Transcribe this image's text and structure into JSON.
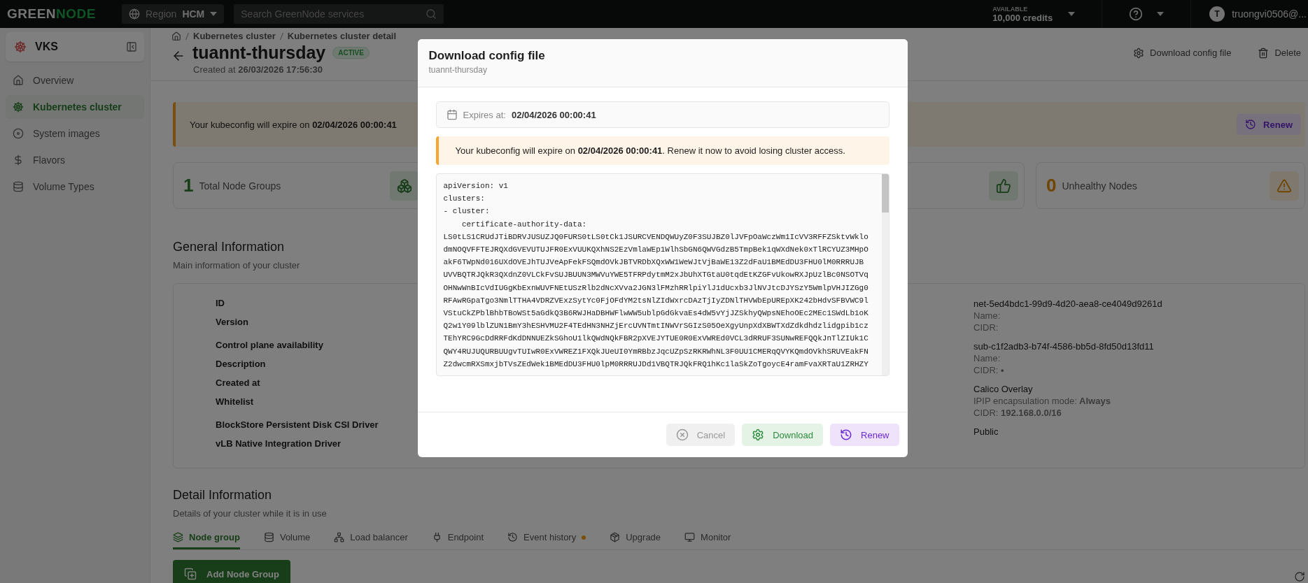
{
  "topbar": {
    "logo": {
      "text": "GREEN",
      "accent": "NODE"
    },
    "region": {
      "label": "Region",
      "value": "HCM"
    },
    "search": {
      "placeholder": "Search GreenNode services"
    },
    "credits": {
      "caption": "AVAILABLE",
      "value": "10,000 credits"
    },
    "user": {
      "initial": "T",
      "name": "truongvi0506@..."
    }
  },
  "sidebar": {
    "product": "VKS",
    "items": [
      {
        "label": "Overview",
        "selected": false
      },
      {
        "label": "Kubernetes cluster",
        "selected": true
      },
      {
        "label": "System images",
        "selected": false
      },
      {
        "label": "Flavors",
        "selected": false
      },
      {
        "label": "Volume Types",
        "selected": false
      }
    ]
  },
  "page": {
    "breadcrumbs": [
      "Kubernetes cluster",
      "Kubernetes cluster detail"
    ],
    "title": "tuannt-thursday",
    "status": "ACTIVE",
    "created_label": "Created at",
    "created_value": "26/03/2026 17:56:30",
    "actions": [
      "Download config file",
      "Delete"
    ]
  },
  "banner": {
    "text": "Your kubeconfig will expire on **02/04/2026 00:00:41**",
    "button": "Renew"
  },
  "stats": [
    {
      "value": "1",
      "label": "Total Node Groups",
      "kind": "total"
    },
    {
      "kind": "healthy"
    },
    {
      "value": "0",
      "label": "Unhealthy Nodes",
      "kind": "unhealthy"
    }
  ],
  "general": {
    "title": "General Information",
    "subtitle": "Main information of your cluster",
    "labels": [
      "ID",
      "Version",
      "Control plane availability",
      "Description",
      "Created at",
      "Whitelist",
      "BlockStore Persistent Disk CSI Driver",
      "vLB Native Integration Driver"
    ],
    "details": [
      {
        "value": "net-5ed4bdc1-99d9-4d20-aea8-ce4049d9261d",
        "lines": [
          {
            "label": "Name:"
          },
          {
            "label": "CIDR:"
          }
        ]
      },
      {
        "value": "sub-c1f2adb3-b74f-4586-bb5d-8fd50d13fd11",
        "lines": [
          {
            "label": "Name:"
          },
          {
            "label": "CIDR:",
            "value": "•"
          }
        ]
      },
      {
        "value": "Calico Overlay",
        "lines": [
          {
            "label": "IPIP encapsulation mode:",
            "value": "Always"
          },
          {
            "label": "CIDR:",
            "value": "192.168.0.0/16"
          }
        ]
      },
      {
        "value": "Public"
      }
    ]
  },
  "detail": {
    "title": "Detail Information",
    "subtitle": "Details of your cluster while it is in use",
    "tabs": [
      {
        "label": "Node group",
        "selected": true,
        "notify": false
      },
      {
        "label": "Volume",
        "selected": false,
        "notify": false
      },
      {
        "label": "Load balancer",
        "selected": false,
        "notify": false
      },
      {
        "label": "Endpoint",
        "selected": false,
        "notify": false
      },
      {
        "label": "Event history",
        "selected": false,
        "notify": true
      },
      {
        "label": "Upgrade",
        "selected": false,
        "notify": false
      },
      {
        "label": "Monitor",
        "selected": false,
        "notify": false
      }
    ],
    "add_button": "Add Node Group"
  },
  "modal": {
    "title": "Download config file",
    "subtitle": "tuannt-thursday",
    "expires_label": "Expires at:",
    "expires_value": "02/04/2026 00:00:41",
    "warning": "Your kubeconfig will expire on **02/04/2026 00:00:41**. Renew it now to avoid losing cluster access.",
    "config_lines": [
      "apiVersion: v1",
      "clusters:",
      "- cluster:",
      "    certificate-authority-data:",
      "LS0tLS1CRUdJTiBDRVJUSUZJQ0FURS0tLS0tCk1JSURCVENDQWUyZ0F3SUJBZ0lJVFpOaWczWm1IcVV3RFFZSktvWklo",
      "dmNOQVFFTEJRQXdGVEVUTUJFR0ExVUUKQXhNS2EzVmlaWEp1WlhSbGN6QWVGdzB5TmpBek1qWXdNek0xTlRCYUZ3MHpO",
      "akF6TWpNd016UXdOVEJhTUJVeApFekFSQmdOVkJBTVRDbXQxWW1WeWJtVjBaWE13Z2dFaU1BMEdDU3FHU0lM0RRRUJB",
      "UVVBQTRJQkR3QXdnZ0VLCkFvSUJBUUN3MWVuYWE5TFRPdytmM2xJbUhXTGtaU0tqdEtKZGFvUkowRXJpUzlBc0NSOTVq",
      "OHNwWnBIcVdIUGgKbExnWUVFNEtUSzRlb2dNcXVva2JGN3lFMzhRRlpiYlJ1dUcxb3JlNVJtcDJYSzY5WmlpVHJIZGg0",
      "RFAwRGpaTgo3NmlTTHA4VDRZVExzSytYc0FjOFdYM2tsNlZIdWxrcDAzTjIyZDNlTHVWbEpUREpXK242bHdvSFBVWC9l",
      "VStuCkZPblBhbTBoWSt5aGdkQ3B6RWJHaDBHWFlwWW5ublpGdGkvaEs4dW5vYjJZSkhyQWpsNEhoOEc2MEc1SWdLb1oK",
      "Q2w1Y09lblZUN1BmY3hESHVMU2F4TEdHN3NHZjErcUVNTmtINWVrSGIzS05OeXgyUnpXdXBWTXdZdkdhdzlidgpib1cz",
      "TEhYRC9GcDdRRFdKdDNNUEZkSGhoU1lkQWdNQkFBR2pXVEJYTUE0R0ExVWREd0VCL3dRRUF3SUNwREFQQkJnTlZIUk1C",
      "QWY4RUJUQURBUUgvTUIwR0ExVWREZ1FXQkJUeUI0YmRBbzJqcUZpSzRKRWhNL3F0UU1CMERqQVYKQmdOVkhSRUVEakFN",
      "Z2dwcmRXSmxjbTVsZEdWek1BMEdDU3FHU0lpM0RRRUJDd1VBQTRJQkFRQ1hKc1laSkZoTgoycE4ramFvaXRTaU1ZRHZY"
    ],
    "buttons": [
      {
        "label": "Cancel",
        "kind": "cancel"
      },
      {
        "label": "Download",
        "kind": "download"
      },
      {
        "label": "Renew",
        "kind": "renew"
      }
    ]
  }
}
